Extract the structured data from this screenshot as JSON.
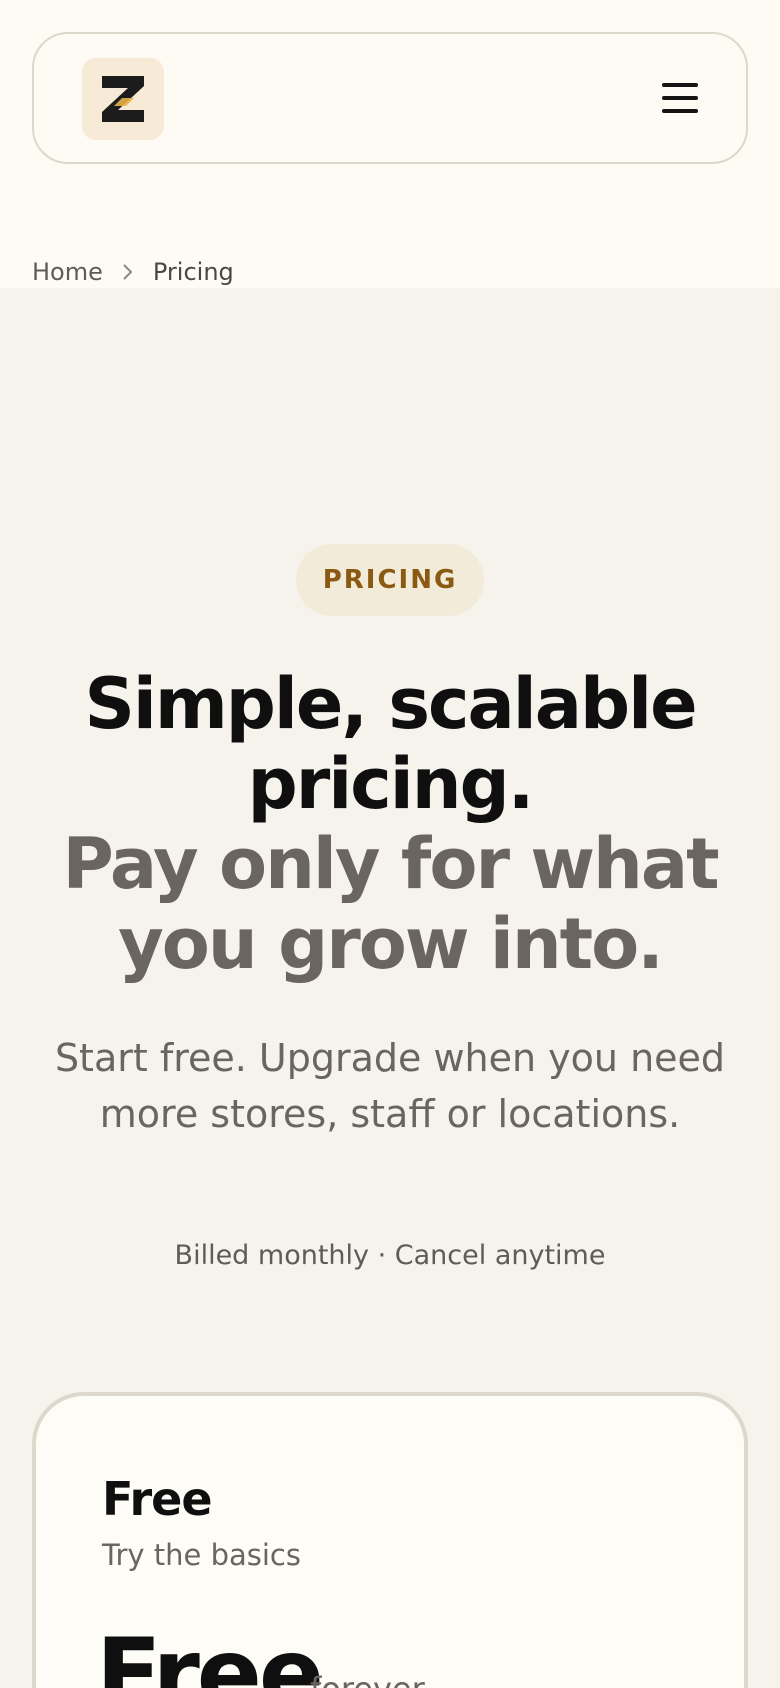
{
  "header": {
    "logo_letter": "Z",
    "menu_icon": "hamburger-icon"
  },
  "breadcrumb": {
    "home": "Home",
    "separator_icon": "chevron-right-icon",
    "current": "Pricing"
  },
  "hero": {
    "eyebrow": "PRICING",
    "headline_line1": "Simple, scalable pricing.",
    "headline_line2": "Pay only for what you grow into.",
    "subtitle": "Start free. Upgrade when you need more stores, staff or locations.",
    "billing_note": "Billed monthly · Cancel anytime"
  },
  "plans": [
    {
      "name": "Free",
      "tagline": "Try the basics",
      "price": "Free",
      "period": "forever"
    }
  ],
  "colors": {
    "background": "#f5f3ec",
    "top_band": "#fdfbf3",
    "accent_text": "#8a5a12",
    "pill_bg": "#f3ebd9",
    "logo_bg": "#f7ead6",
    "logo_accent": "#e8b04a"
  }
}
